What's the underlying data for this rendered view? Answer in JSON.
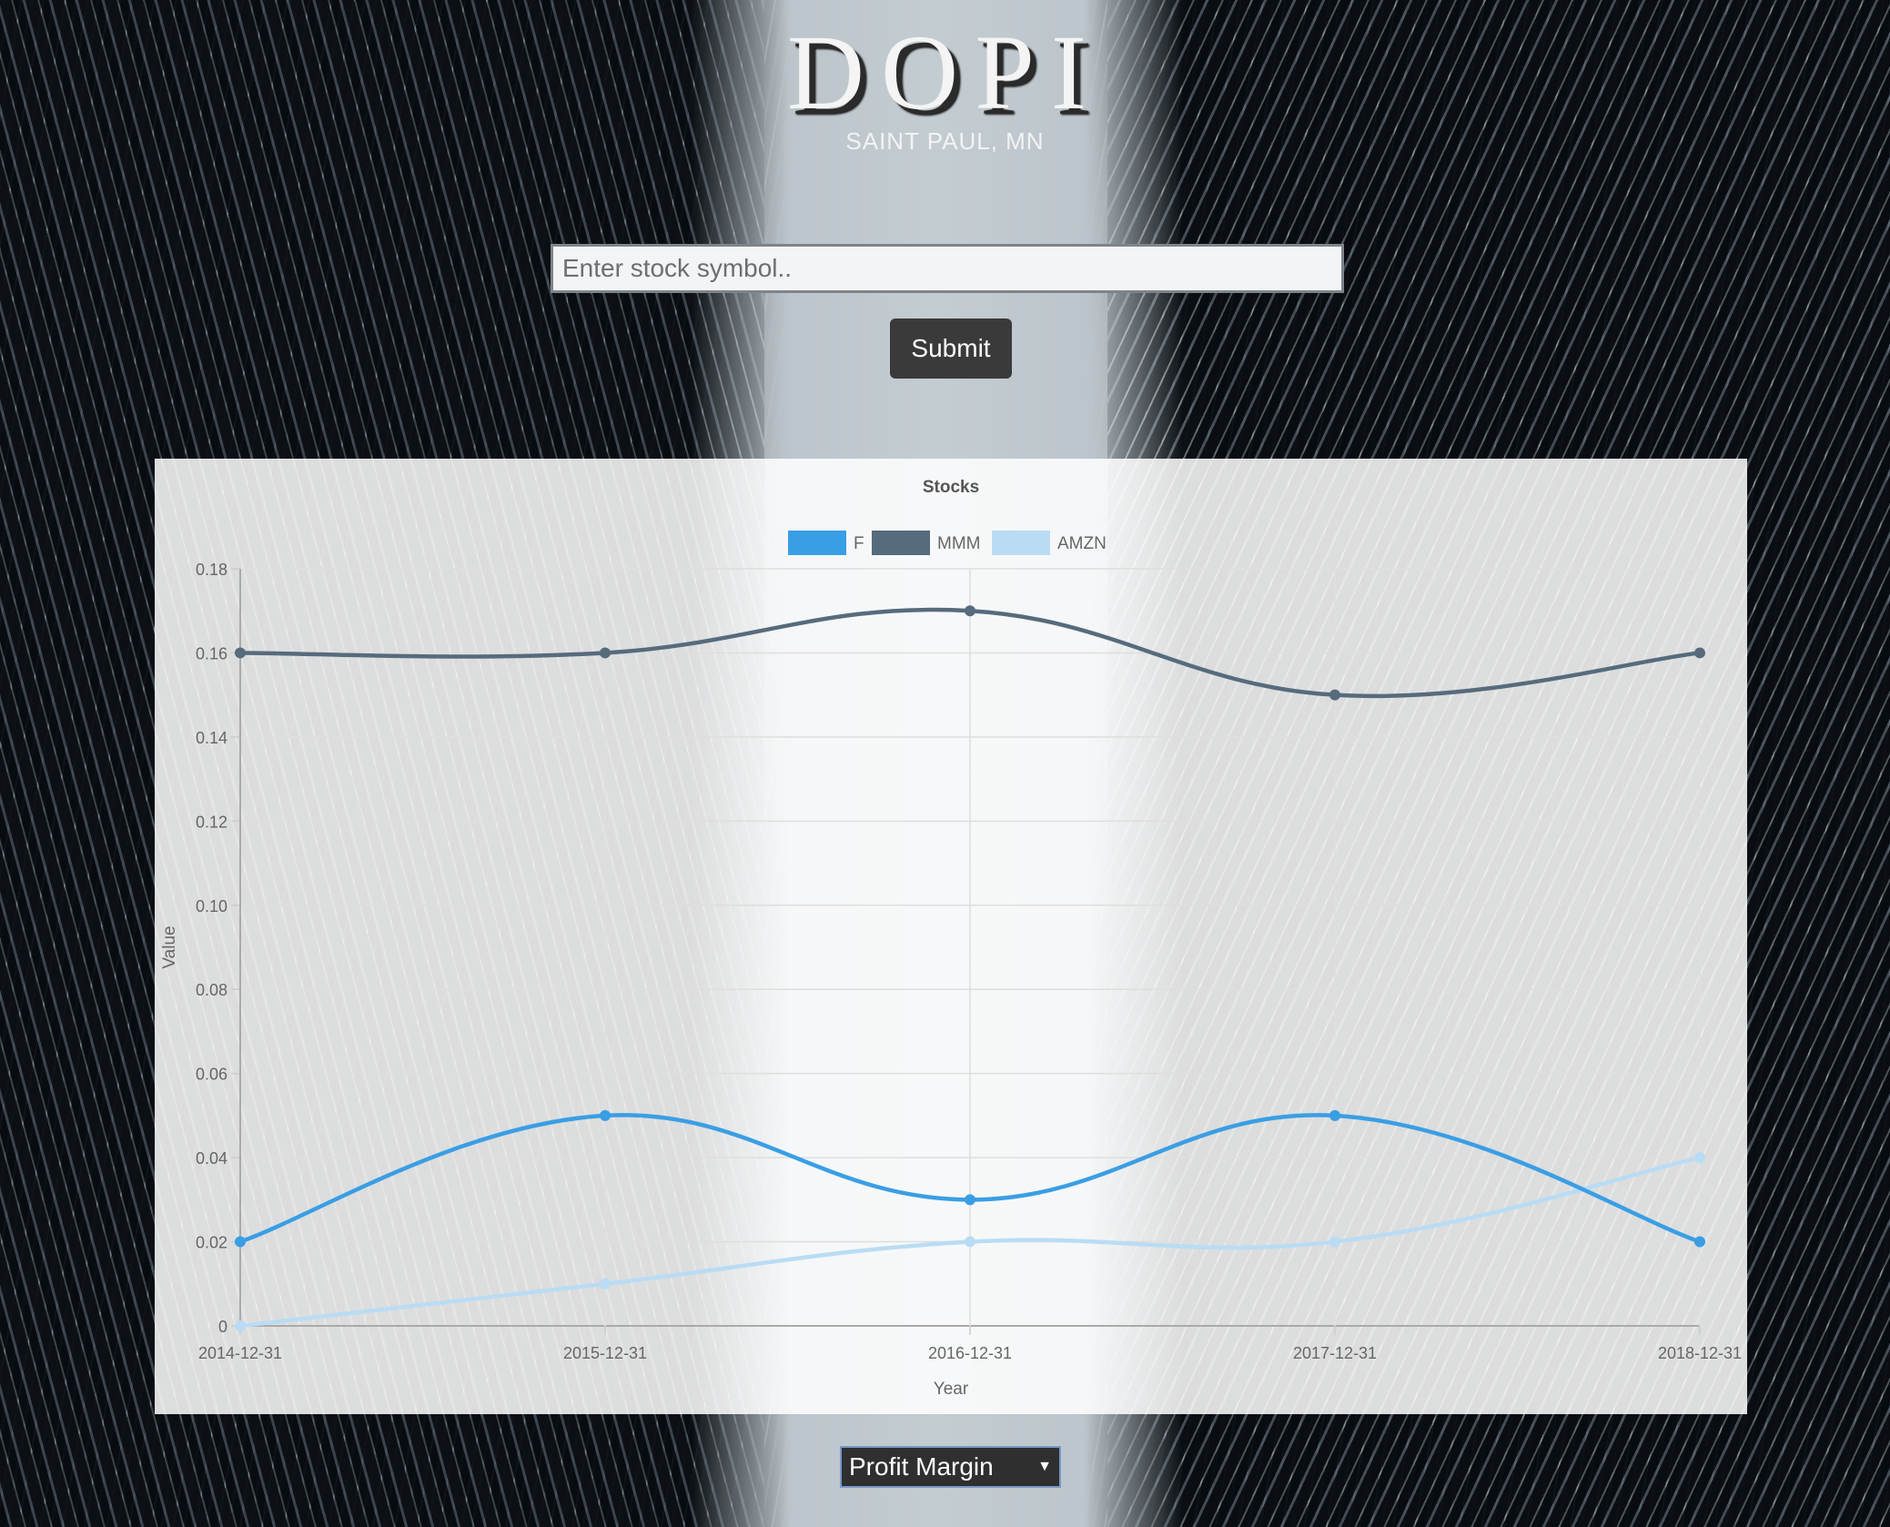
{
  "header": {
    "logo": "DOPI",
    "location": "SAINT PAUL, MN"
  },
  "search": {
    "placeholder": "Enter stock symbol..",
    "value": ""
  },
  "submit_label": "Submit",
  "metric_select": {
    "selected": "Profit Margin"
  },
  "colors": {
    "F": "#3a9ee4",
    "MMM": "#566b7c",
    "AMZN": "#b9dcf4"
  },
  "chart_data": {
    "type": "line",
    "title": "Stocks",
    "xlabel": "Year",
    "ylabel": "Value",
    "categories": [
      "2014-12-31",
      "2015-12-31",
      "2016-12-31",
      "2017-12-31",
      "2018-12-31"
    ],
    "ylim": [
      0,
      0.18
    ],
    "yticks": [
      "0",
      "0.02",
      "0.04",
      "0.06",
      "0.08",
      "0.10",
      "0.12",
      "0.14",
      "0.16",
      "0.18"
    ],
    "grid": true,
    "legend_position": "top",
    "series": [
      {
        "name": "F",
        "values": [
          0.02,
          0.05,
          0.03,
          0.05,
          0.02
        ]
      },
      {
        "name": "MMM",
        "values": [
          0.16,
          0.16,
          0.17,
          0.15,
          0.16
        ]
      },
      {
        "name": "AMZN",
        "values": [
          0.0,
          0.01,
          0.02,
          0.02,
          0.04
        ]
      }
    ]
  }
}
